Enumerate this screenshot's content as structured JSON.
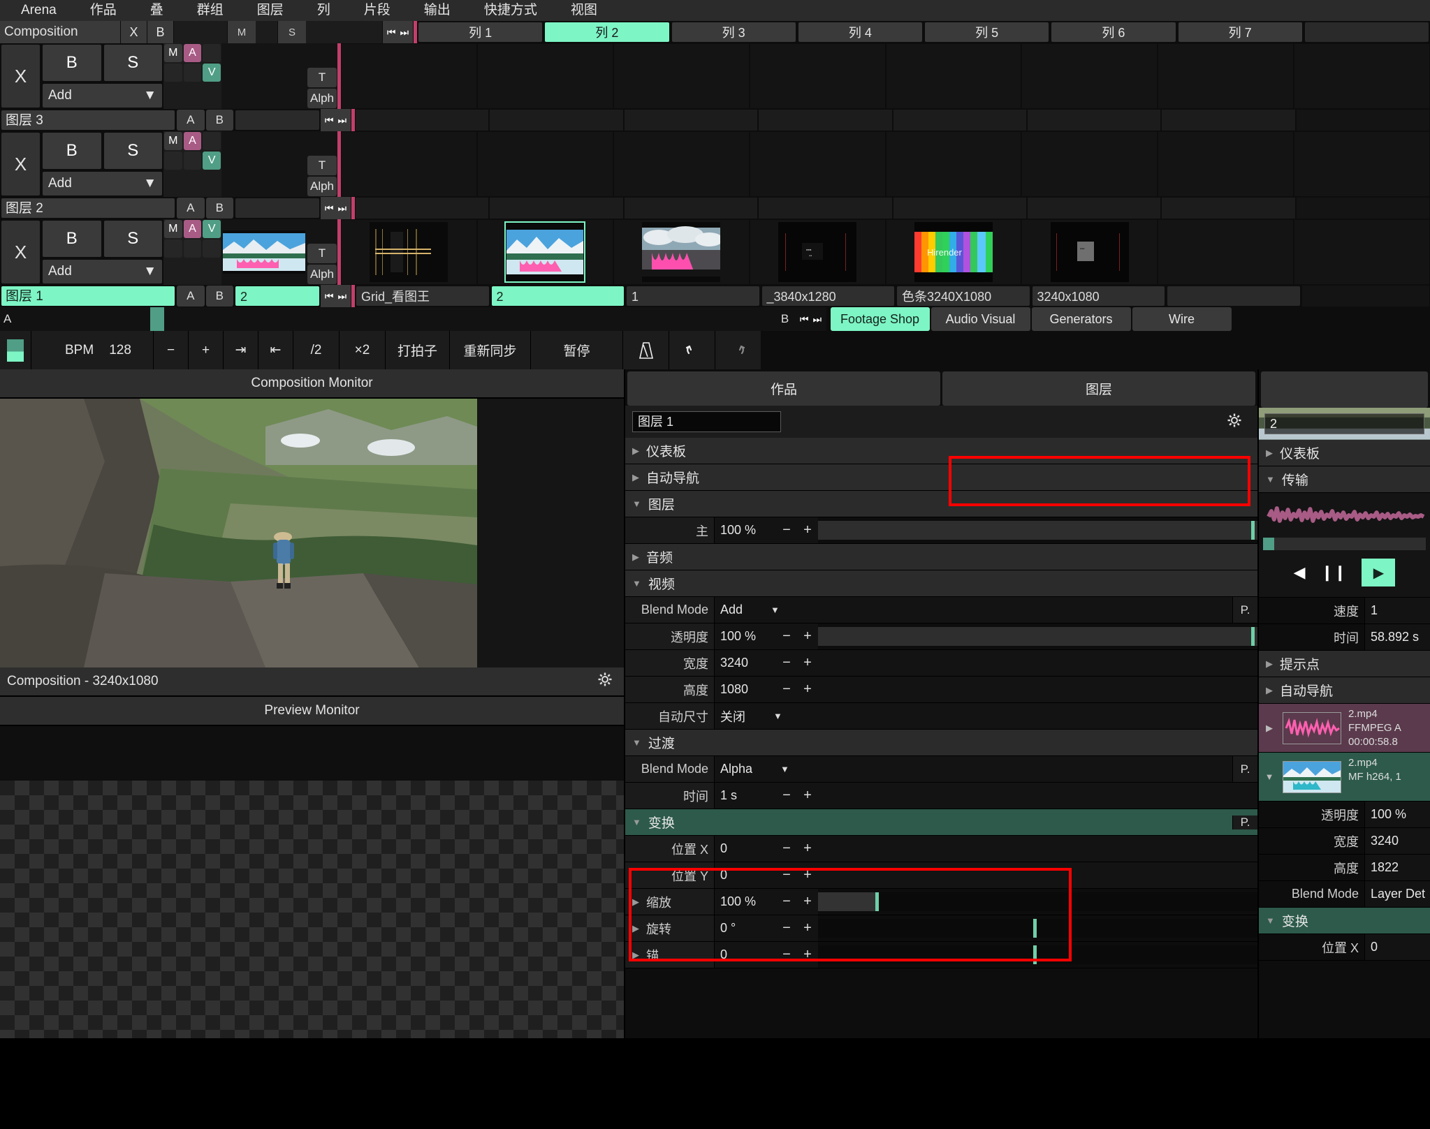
{
  "menubar": {
    "items": [
      "Arena",
      "作品",
      "叠",
      "群组",
      "图层",
      "列",
      "片段",
      "输出",
      "快捷方式",
      "视图"
    ]
  },
  "composition": {
    "name": "Composition",
    "close_label": "X",
    "b_label": "B",
    "m_label": "M",
    "s_label": "S",
    "nav_prev": "⏮",
    "nav_next": "⏭",
    "columns": [
      {
        "label": "列 1",
        "selected": false
      },
      {
        "label": "列 2",
        "selected": true
      },
      {
        "label": "列 3",
        "selected": false
      },
      {
        "label": "列 4",
        "selected": false
      },
      {
        "label": "列 5",
        "selected": false
      },
      {
        "label": "列 6",
        "selected": false
      },
      {
        "label": "列 7",
        "selected": false
      }
    ]
  },
  "layers": [
    {
      "name": "图层 3",
      "selected": false,
      "x_label": "X",
      "b_label": "B",
      "s_label": "S",
      "blend_mode": "Add",
      "chips": {
        "m": "M",
        "a": "A",
        "v": "V"
      },
      "a_label": "A",
      "ab_b_label": "B",
      "t_label": "T",
      "alpha_label": "Alph",
      "has_thumb": false,
      "clip_label": "",
      "clips": [
        "",
        "",
        "",
        "",
        "",
        "",
        ""
      ]
    },
    {
      "name": "图层 2",
      "selected": false,
      "x_label": "X",
      "b_label": "B",
      "s_label": "S",
      "blend_mode": "Add",
      "chips": {
        "m": "M",
        "a": "A",
        "v": "V"
      },
      "a_label": "A",
      "ab_b_label": "B",
      "t_label": "T",
      "alpha_label": "Alph",
      "has_thumb": false,
      "clip_label": "",
      "clips": [
        "",
        "",
        "",
        "",
        "",
        "",
        ""
      ]
    },
    {
      "name": "图层 1",
      "selected": true,
      "x_label": "X",
      "b_label": "B",
      "s_label": "S",
      "blend_mode": "Add",
      "chips": {
        "m": "M",
        "a": "A",
        "v": "V"
      },
      "a_label": "A",
      "ab_b_label": "B",
      "t_label": "T",
      "alpha_label": "Alph",
      "has_thumb": true,
      "clip_label": "2",
      "clips": [
        "Grid_看图王",
        "2",
        "1",
        "_3840x1280",
        "色条3240X1080",
        "3240x1080",
        ""
      ]
    }
  ],
  "master_row": {
    "a_label": "A",
    "b_label": "B",
    "nav_prev": "⏮",
    "nav_next": "⏭",
    "source_tabs": [
      {
        "label": "Footage Shop",
        "selected": true
      },
      {
        "label": "Audio Visual",
        "selected": false
      },
      {
        "label": "Generators",
        "selected": false
      },
      {
        "label": "Wire",
        "selected": false
      }
    ]
  },
  "bpm_bar": {
    "bpm_label": "BPM",
    "bpm_value": "128",
    "minus": "−",
    "plus": "+",
    "nudge_left": "⇥",
    "nudge_right": "⇤",
    "half": "/2",
    "double": "×2",
    "tap": "打拍子",
    "resync": "重新同步",
    "pause": "暂停",
    "metronome_icon": "metronome-icon",
    "undo_icon": "undo-icon",
    "redo_icon": "redo-icon"
  },
  "monitors": {
    "composition_monitor_title": "Composition Monitor",
    "composition_info": "Composition - 3240x1080",
    "preview_monitor_title": "Preview Monitor",
    "gear_icon": "gear-icon"
  },
  "param_panel": {
    "tabs": [
      {
        "label": "作品",
        "active": false
      },
      {
        "label": "图层",
        "active": true
      }
    ],
    "name_value": "图层 1",
    "gear_icon": "gear-icon",
    "sections": [
      {
        "type": "section",
        "label": "仪表板",
        "open": false
      },
      {
        "type": "section",
        "label": "自动导航",
        "open": false
      },
      {
        "type": "section",
        "label": "图层",
        "open": true
      },
      {
        "type": "slider",
        "label": "主",
        "value": "100 %",
        "minus": "−",
        "plus": "+",
        "mark_pct": 98.5,
        "fill_pct": 0
      },
      {
        "type": "section",
        "label": "音频",
        "open": false
      },
      {
        "type": "section",
        "label": "视频",
        "open": true
      },
      {
        "type": "select",
        "label": "Blend Mode",
        "value": "Add",
        "p_label": "P."
      },
      {
        "type": "slider",
        "label": "透明度",
        "value": "100 %",
        "minus": "−",
        "plus": "+",
        "mark_pct": 98.5,
        "fill_pct": 0
      },
      {
        "type": "number",
        "label": "宽度",
        "value": "3240",
        "minus": "−",
        "plus": "+"
      },
      {
        "type": "number",
        "label": "高度",
        "value": "1080",
        "minus": "−",
        "plus": "+"
      },
      {
        "type": "select",
        "label": "自动尺寸",
        "value": "关闭",
        "p_label": ""
      },
      {
        "type": "section",
        "label": "过渡",
        "open": true
      },
      {
        "type": "select",
        "label": "Blend Mode",
        "value": "Alpha",
        "p_label": "P."
      },
      {
        "type": "number",
        "label": "时间",
        "value": "1 s",
        "minus": "−",
        "plus": "+"
      },
      {
        "type": "section-green",
        "label": "变换",
        "open": true,
        "p_label": "P."
      },
      {
        "type": "number",
        "label": "位置 X",
        "value": "0",
        "minus": "−",
        "plus": "+"
      },
      {
        "type": "number",
        "label": "位置 Y",
        "value": "0",
        "minus": "−",
        "plus": "+"
      },
      {
        "type": "slider-tri",
        "label": "缩放",
        "value": "100 %",
        "minus": "−",
        "plus": "+",
        "mark_pct": 14,
        "fill_pct": 13
      },
      {
        "type": "slider-tri",
        "label": "旋转",
        "value": "0 °",
        "minus": "−",
        "plus": "+",
        "mark_pct": 49,
        "fill_pct": 0
      },
      {
        "type": "slider-tri",
        "label": "锚",
        "value": "0",
        "minus": "−",
        "plus": "+",
        "mark_pct": 49,
        "fill_pct": 0
      }
    ]
  },
  "clip_panel": {
    "name_value": "2",
    "dashboard_label": "仪表板",
    "transport_label": "传输",
    "prev_icon": "step-back-icon",
    "pause_icon": "pause-icon",
    "play_icon": "play-icon",
    "speed_label": "速度",
    "speed_value": "1",
    "time_label": "时间",
    "time_value": "58.892 s",
    "cuepoints_label": "提示点",
    "autonav_label": "自动导航",
    "assets": [
      {
        "kind": "audio",
        "title": "2.mp4",
        "codec": "FFMPEG A",
        "duration": "00:00:58.8"
      },
      {
        "kind": "video",
        "title": "2.mp4",
        "codec": "MF h264, 1"
      }
    ],
    "props": [
      {
        "label": "透明度",
        "value": "100 %"
      },
      {
        "label": "宽度",
        "value": "3240"
      },
      {
        "label": "高度",
        "value": "1822"
      },
      {
        "label": "Blend Mode",
        "value": "Layer Det"
      }
    ],
    "transform_label": "变换",
    "transform_rows": [
      {
        "label": "位置 X",
        "value": "0"
      }
    ]
  },
  "colors": {
    "accent_mint": "#7df5c4",
    "chip_magenta": "#a85b85",
    "chip_teal": "#4f9e85",
    "section_green": "#2d5a4b",
    "annotation_red": "#ff0000",
    "playhead_pink": "#c23f6b"
  }
}
